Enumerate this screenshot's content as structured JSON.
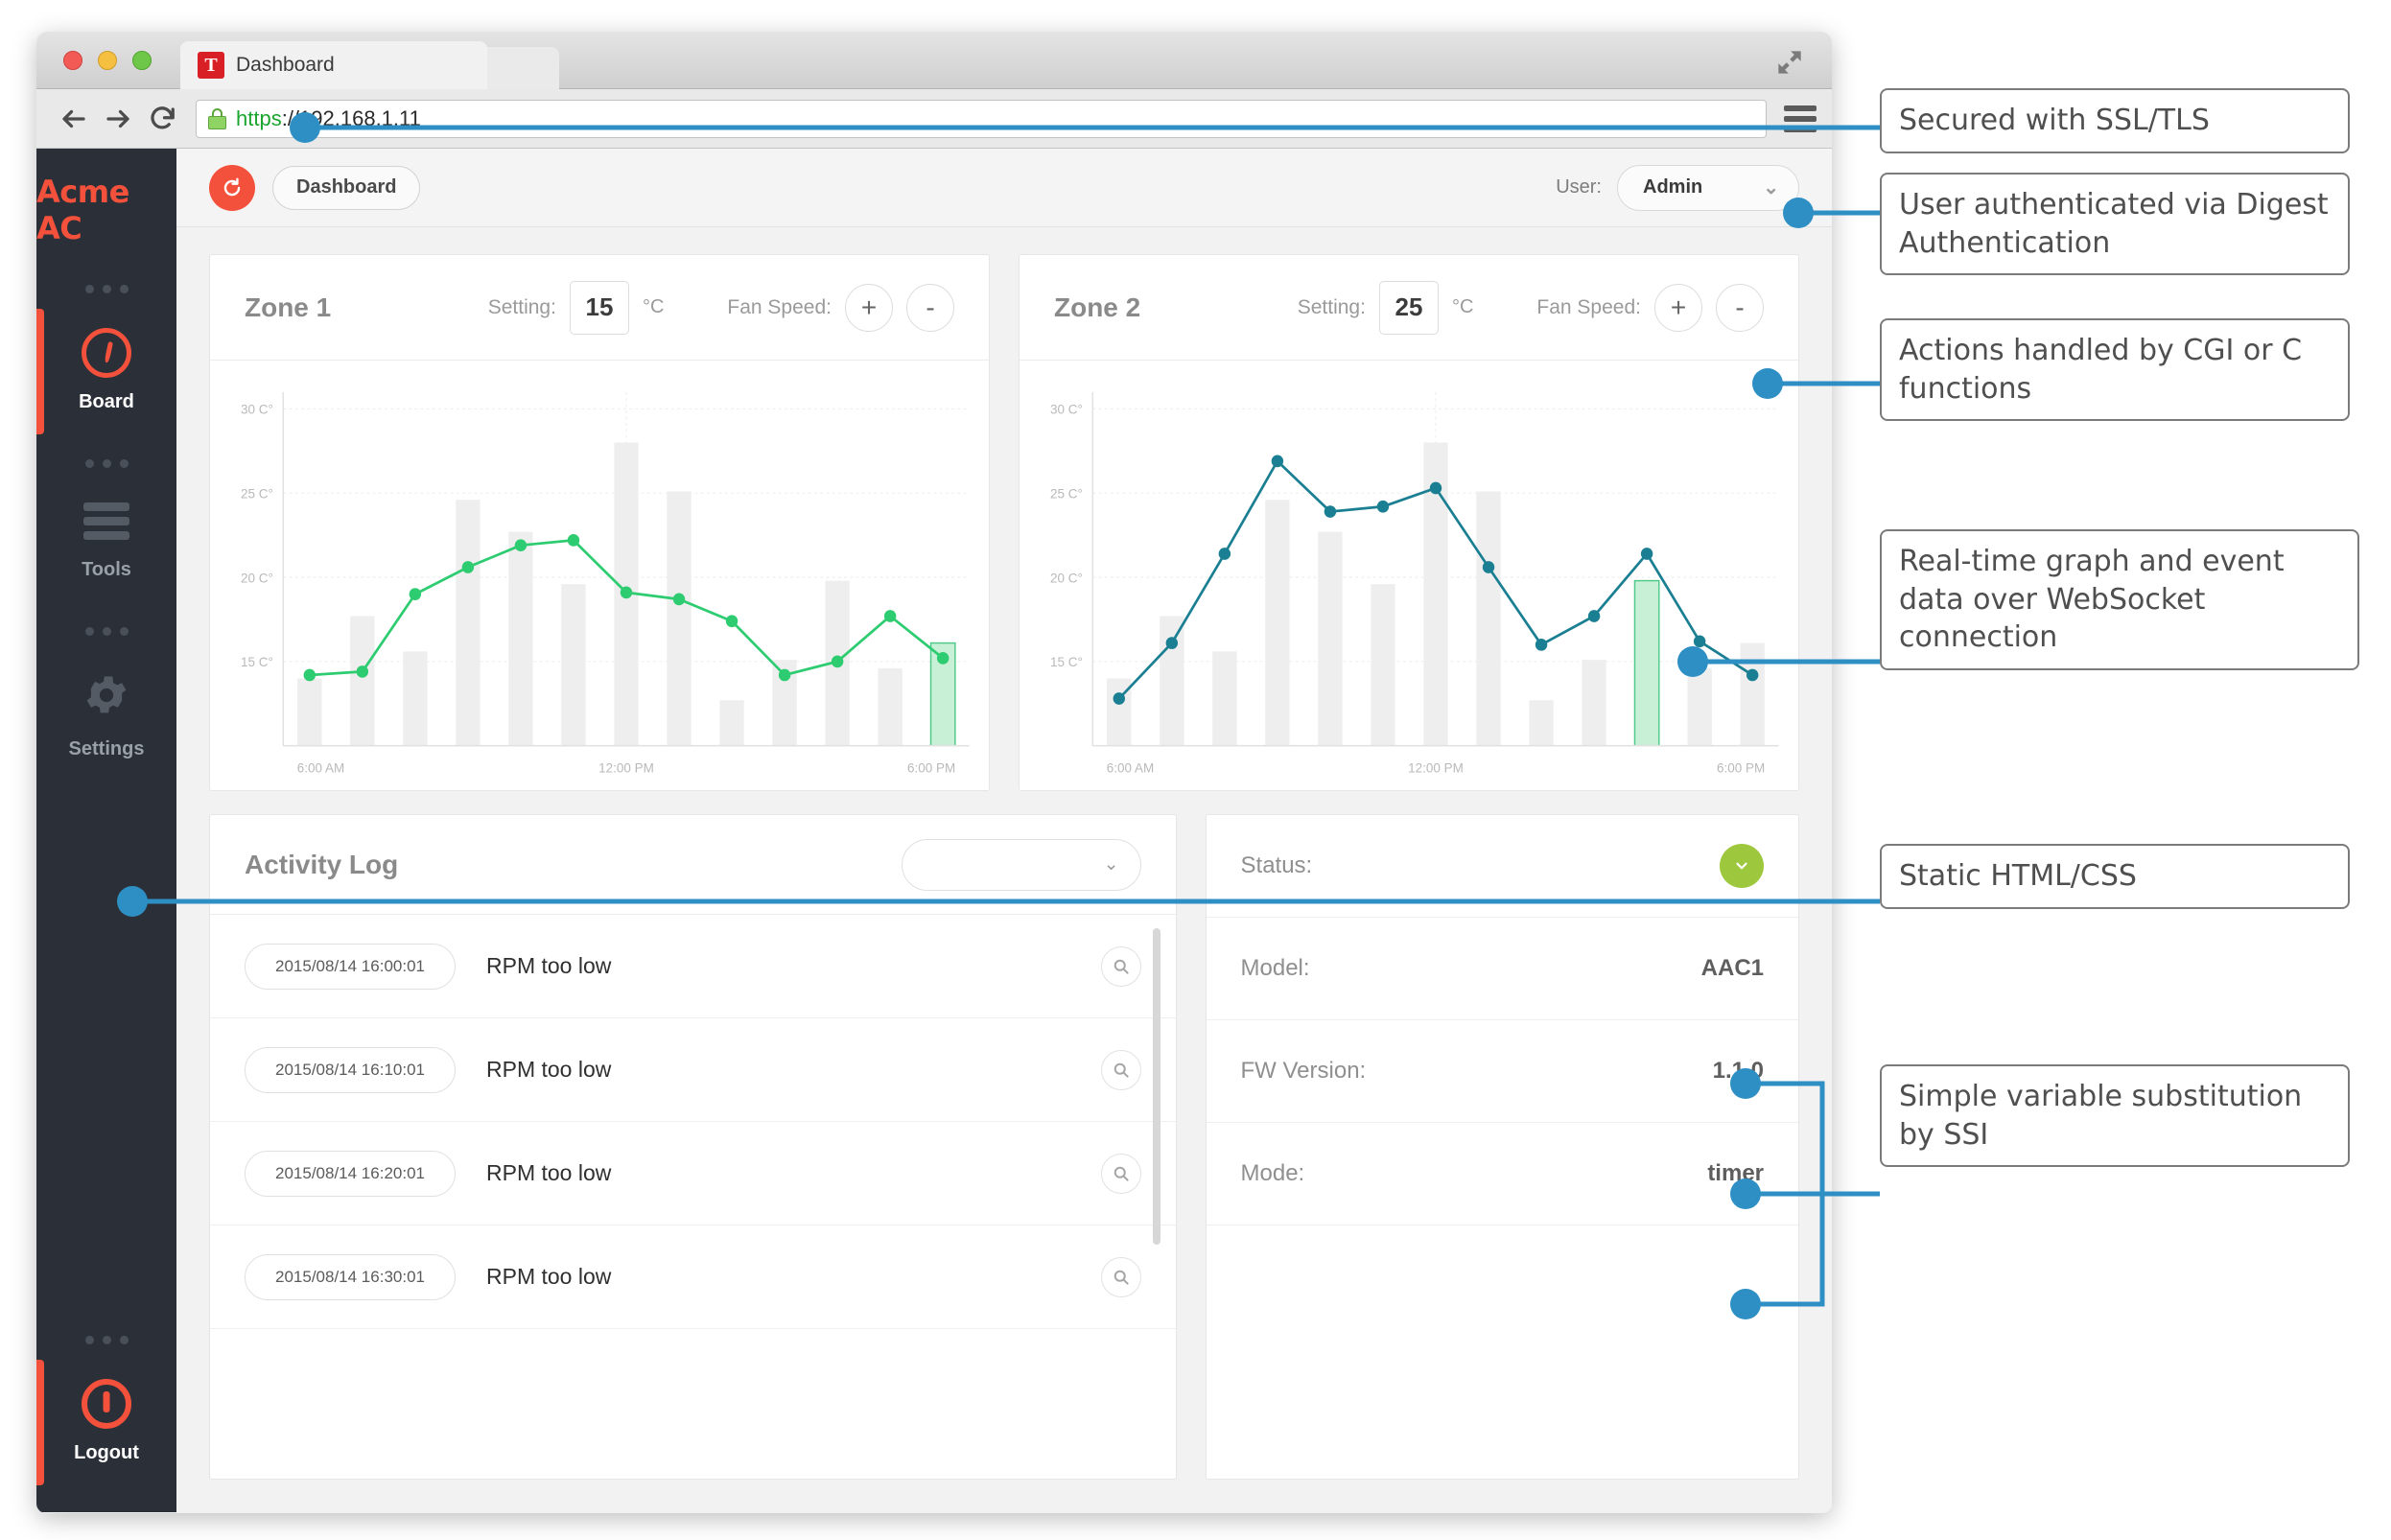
{
  "browser": {
    "tab_title": "Dashboard",
    "favicon_letter": "T",
    "url_scheme": "https",
    "url_rest": "://192.168.1.11",
    "back_icon": "arrow-left-icon",
    "forward_icon": "arrow-right-icon",
    "reload_icon": "reload-icon",
    "lock_icon": "lock-icon",
    "menu_icon": "hamburger-menu-icon",
    "expand_icon": "expand-icon"
  },
  "sidebar": {
    "brand": "Acme AC",
    "items": [
      {
        "label": "Board",
        "icon": "gauge-icon",
        "active": true
      },
      {
        "label": "Tools",
        "icon": "stack-icon",
        "active": false
      },
      {
        "label": "Settings",
        "icon": "gear-icon",
        "active": false
      }
    ],
    "logout": {
      "label": "Logout",
      "icon": "power-icon"
    }
  },
  "toolbar": {
    "refresh_icon": "refresh-circle-icon",
    "dashboard_label": "Dashboard",
    "user_label": "User:",
    "user_value": "Admin",
    "user_chevron": "chevron-down-icon"
  },
  "zones": [
    {
      "title": "Zone 1",
      "setting_label": "Setting:",
      "setting_value": "15",
      "unit": "°C",
      "fan_label": "Fan Speed:",
      "plus": "+",
      "minus": "-"
    },
    {
      "title": "Zone 2",
      "setting_label": "Setting:",
      "setting_value": "25",
      "unit": "°C",
      "fan_label": "Fan Speed:",
      "plus": "+",
      "minus": "-"
    }
  ],
  "chart_data": [
    {
      "type": "line",
      "title": "Zone 1",
      "xlabel": "",
      "ylabel": "",
      "ylim": [
        10,
        31
      ],
      "yticks": [
        15,
        20,
        25,
        30
      ],
      "ytick_labels": [
        "15 C°",
        "20 C°",
        "25 C°",
        "30 C°"
      ],
      "xtick_labels": [
        "6:00 AM",
        "12:00 PM",
        "6:00 PM"
      ],
      "xtick_index": [
        0,
        7,
        14
      ],
      "grid": true,
      "line_color": "#2ecc71",
      "bar_color": "#eeeeee",
      "highlight_bar_color": "#c8f0d6",
      "highlight_bar_index": 12,
      "series": [
        {
          "name": "Temperature",
          "values": [
            14.2,
            14.4,
            19.0,
            20.6,
            21.9,
            22.2,
            19.1,
            18.7,
            17.4,
            14.2,
            15.0,
            17.7,
            15.2
          ]
        }
      ],
      "line_x_index": [
        0,
        1,
        2,
        3,
        4,
        5,
        6,
        7,
        8,
        9,
        10,
        11,
        12
      ],
      "bars": [
        14.0,
        17.7,
        15.6,
        24.6,
        22.7,
        19.6,
        28.0,
        25.1,
        12.7,
        15.1,
        19.8,
        14.6,
        16.1
      ]
    },
    {
      "type": "line",
      "title": "Zone 2",
      "xlabel": "",
      "ylabel": "",
      "ylim": [
        10,
        31
      ],
      "yticks": [
        15,
        20,
        25,
        30
      ],
      "ytick_labels": [
        "15 C°",
        "20 C°",
        "25 C°",
        "30 C°"
      ],
      "xtick_labels": [
        "6:00 AM",
        "12:00 PM",
        "6:00 PM"
      ],
      "xtick_index": [
        0,
        7,
        14
      ],
      "grid": true,
      "line_color": "#1a7f92",
      "bar_color": "#eeeeee",
      "highlight_bar_color": "#c8f0d6",
      "highlight_bar_index": 10,
      "series": [
        {
          "name": "Temperature",
          "values": [
            12.8,
            16.1,
            21.4,
            26.9,
            23.9,
            24.2,
            25.3,
            20.6,
            16.0,
            17.7,
            21.4,
            16.2,
            14.2
          ]
        }
      ],
      "line_x_index": [
        0,
        1,
        2,
        3,
        4,
        5,
        6,
        7,
        8,
        9,
        10,
        11,
        12
      ],
      "bars": [
        14.0,
        17.7,
        15.6,
        24.6,
        22.7,
        19.6,
        28.0,
        25.1,
        12.7,
        15.1,
        19.8,
        14.6,
        16.1
      ]
    }
  ],
  "activity_log": {
    "title": "Activity Log",
    "filter_value": "",
    "filter_chevron": "chevron-down-icon",
    "search_icon": "magnifier-icon",
    "rows": [
      {
        "timestamp": "2015/08/14 16:00:01",
        "message": "RPM too low"
      },
      {
        "timestamp": "2015/08/14 16:10:01",
        "message": "RPM too low"
      },
      {
        "timestamp": "2015/08/14 16:20:01",
        "message": "RPM too low"
      },
      {
        "timestamp": "2015/08/14 16:30:01",
        "message": "RPM too low"
      }
    ]
  },
  "status_panel": {
    "rows": [
      {
        "label": "Status:",
        "value": "",
        "badge": true,
        "badge_color": "#9dc73d",
        "badge_icon": "chevron-down-icon"
      },
      {
        "label": "Model:",
        "value": "AAC1",
        "badge": false
      },
      {
        "label": "FW Version:",
        "value": "1.1.0",
        "badge": false
      },
      {
        "label": "Mode:",
        "value": "timer",
        "badge": false
      }
    ]
  },
  "annotations": {
    "accent_color": "#2e8fc4",
    "items": [
      {
        "text": "Secured with SSL/TLS"
      },
      {
        "text": "User authenticated via Digest Authentication"
      },
      {
        "text": "Actions handled by CGI or C functions"
      },
      {
        "text": "Real-time graph and event data over WebSocket connection"
      },
      {
        "text": "Static HTML/CSS"
      },
      {
        "text": "Simple variable substitution by SSI"
      }
    ]
  }
}
